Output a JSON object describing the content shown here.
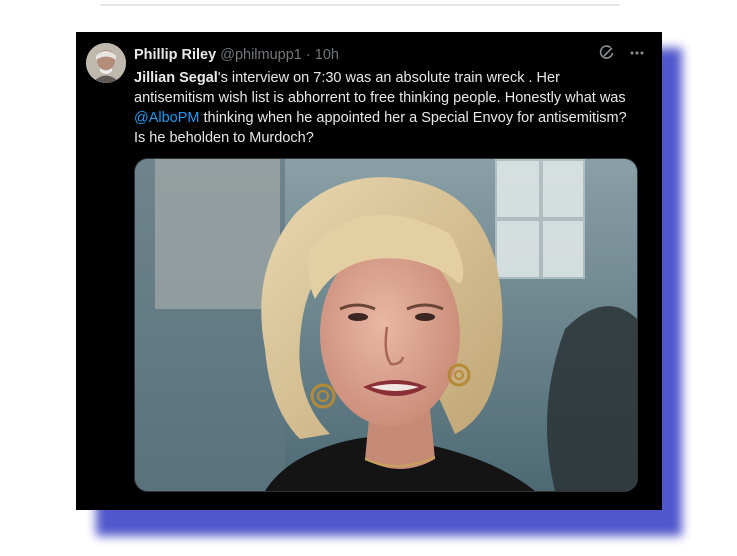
{
  "tweet": {
    "author_name": "Phillip Riley",
    "handle": "@philmupp1",
    "separator": "·",
    "timestamp": "10h",
    "text_parts": {
      "bold_name": "Jillian Segal",
      "line1_rest": "'s interview on 7:30 was an absolute train wreck . Her antisemitism wish list is abhorrent to free thinking people. Honestly what was ",
      "mention": "@AlboPM",
      "line_end": " thinking when he appointed her a Special Envoy for antisemitism? Is he beholden to Murdoch?"
    },
    "icons": {
      "grok": "grok-icon",
      "more": "more-icon"
    }
  },
  "colors": {
    "card_bg": "#000000",
    "shadow": "#3f45c7",
    "mention": "#1d9bf0",
    "muted": "#71767b",
    "text": "#e7e9ea"
  }
}
